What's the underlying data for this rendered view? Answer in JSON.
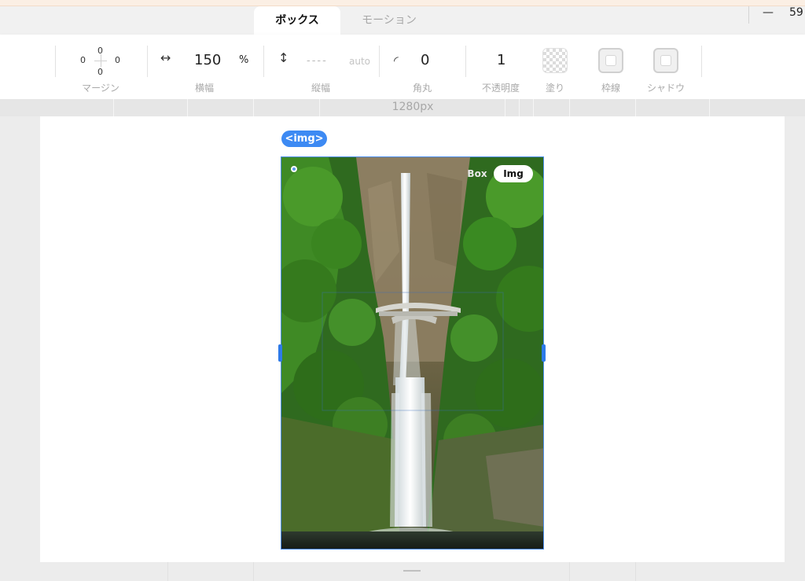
{
  "tabs": {
    "box_label": "ボックス",
    "motion_label": "モーション"
  },
  "window": {
    "minimize_glyph": "—",
    "zoom_value": "59"
  },
  "toolbar": {
    "margin": {
      "top": "0",
      "right": "0",
      "bottom": "0",
      "left": "0",
      "label": "マージン"
    },
    "width": {
      "icon": "↔",
      "value": "150",
      "unit": "%",
      "label": "横幅"
    },
    "height": {
      "icon": "↕",
      "placeholder": "----",
      "auto": "auto",
      "label": "縦幅"
    },
    "radius": {
      "icon": "◜",
      "value": "0",
      "label": "角丸"
    },
    "opacity": {
      "value": "1",
      "label": "不透明度"
    },
    "fill": {
      "label": "塗り"
    },
    "border": {
      "label": "枠線"
    },
    "shadow": {
      "label": "シャドウ"
    }
  },
  "ruler": {
    "width_text": "1280px"
  },
  "selection": {
    "tag": "<img>",
    "mode_box": "Box",
    "mode_img": "Img",
    "accent_color": "#3d8af3"
  }
}
